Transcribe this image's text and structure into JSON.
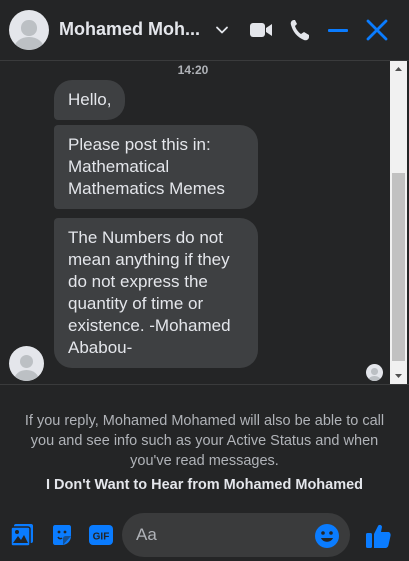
{
  "header": {
    "contact_name": "Mohamed Moh...",
    "icons": [
      "chevron-down-icon",
      "video-call-icon",
      "phone-icon",
      "minimize-icon",
      "close-icon"
    ],
    "accent_color": "#0a7cff"
  },
  "chat": {
    "timestamp": "14:20",
    "messages": [
      {
        "text": "Hello,"
      },
      {
        "text": "Please post this in: Mathematical Mathematics Memes"
      },
      {
        "text": "The Numbers do not mean anything if they do not express the quantity of time or existence. -Mohamed Ababou-"
      }
    ]
  },
  "notice": {
    "text": "If you reply, Mohamed Mohamed will also be able to call you and see info such as your Active Status and when you've read messages.",
    "action": "I Don't Want to Hear from Mohamed Mohamed"
  },
  "composer": {
    "placeholder": "Aa",
    "icons": [
      "photo-icon",
      "sticker-icon",
      "gif-icon",
      "emoji-icon",
      "like-icon"
    ]
  }
}
